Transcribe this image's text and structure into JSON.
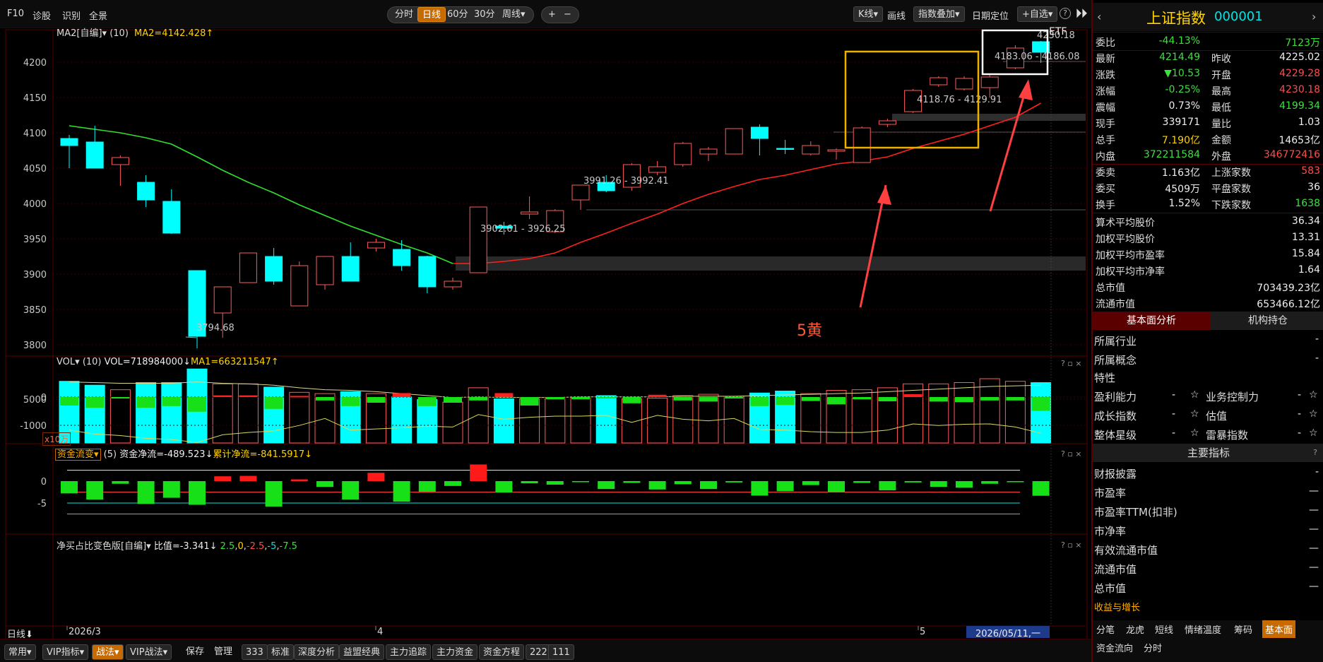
{
  "topbar": {
    "f10": "F10",
    "diagnose": "诊股",
    "identify": "识别",
    "fullview": "全景",
    "periods": [
      "分时",
      "日线",
      "60分",
      "30分",
      "周线▾"
    ],
    "zoom_in": "+",
    "zoom_out": "−",
    "kline": "K线▾",
    "draw": "画线",
    "overlay": "指数叠加▾",
    "date_locate": "日期定位",
    "watchlist": "+自选▾",
    "help": "?"
  },
  "main_panel": {
    "indicator_name": "MA2[自编]▾",
    "param": "(10)",
    "value_text": "MA2=4142.428↑",
    "y_ticks": [
      "4200",
      "4150",
      "4100",
      "4050",
      "4000",
      "3950",
      "3900",
      "3850",
      "3800"
    ],
    "annotations": [
      "3794.68",
      "3902.61 - 3926.25",
      "3991.26 - 3992.41",
      "4118.76 - 4129.91",
      "4183.06 - 4186.08",
      "4230.18"
    ],
    "etf_label": "ETF",
    "callout_text": "5黄"
  },
  "vol_panel": {
    "name": "VOL▾",
    "param": "(10)",
    "vol_text": "VOL=718984000↓",
    "ma_text": "MA1=663211547↑",
    "y_tick": "5000",
    "unit": "x10万"
  },
  "flow_panel": {
    "name": "资金流变▾",
    "param": "(5)",
    "net_text": "资金净流=-489.523↓",
    "acc_text": "累计净流=-841.5917↓",
    "y_ticks": [
      "0",
      "-1000"
    ]
  },
  "ratio_panel": {
    "name": "净买占比变色版[自编]▾",
    "value_text": "比值=-3.341↓",
    "levels": [
      "2.5",
      "0",
      "-2.5",
      "-5",
      "-7.5"
    ],
    "y_ticks": [
      "0",
      "-5"
    ]
  },
  "time_axis": {
    "period_label": "日线⬇",
    "months": [
      "2026/3",
      "4",
      "5"
    ],
    "cursor_date": "2026/05/11,一"
  },
  "bottombar": {
    "items": [
      "常用▾",
      "VIP指标▾",
      "战法▾",
      "VIP战法▾",
      "保存",
      "管理",
      "333",
      "标准",
      "深度分析",
      "益盟经典",
      "主力追踪",
      "主力资金",
      "资金方程",
      "222",
      "111"
    ]
  },
  "quote": {
    "name": "上证指数",
    "code": "000001",
    "rows": [
      {
        "l": "委比",
        "v": "-44.13%",
        "l2": "",
        "v2": "7123万",
        "c": "green",
        "c2": "green"
      },
      {
        "l": "最新",
        "v": "4214.49",
        "l2": "昨收",
        "v2": "4225.02",
        "c": "green",
        "c2": "white"
      },
      {
        "l": "涨跌",
        "v": "▼10.53",
        "l2": "开盘",
        "v2": "4229.28",
        "c": "green",
        "c2": "red"
      },
      {
        "l": "涨幅",
        "v": "-0.25%",
        "l2": "最高",
        "v2": "4230.18",
        "c": "green",
        "c2": "red"
      },
      {
        "l": "震幅",
        "v": "0.73%",
        "l2": "最低",
        "v2": "4199.34",
        "c": "white",
        "c2": "green"
      },
      {
        "l": "现手",
        "v": "339171",
        "l2": "量比",
        "v2": "1.03",
        "c": "white",
        "c2": "white"
      },
      {
        "l": "总手",
        "v": "7.190亿",
        "l2": "金额",
        "v2": "14653亿",
        "c": "yellow",
        "c2": "white"
      },
      {
        "l": "内盘",
        "v": "372211584",
        "l2": "外盘",
        "v2": "346772416",
        "c": "green",
        "c2": "red"
      },
      {
        "l": "委卖",
        "v": "1.163亿",
        "l2": "上涨家数",
        "v2": "583",
        "c": "white",
        "c2": "red"
      },
      {
        "l": "委买",
        "v": "4509万",
        "l2": "平盘家数",
        "v2": "36",
        "c": "white",
        "c2": "white"
      },
      {
        "l": "换手",
        "v": "1.52%",
        "l2": "下跌家数",
        "v2": "1638",
        "c": "white",
        "c2": "green"
      }
    ],
    "stats": [
      {
        "l": "算术平均股价",
        "v": "36.34"
      },
      {
        "l": "加权平均股价",
        "v": "13.31"
      },
      {
        "l": "加权平均市盈率",
        "v": "15.84"
      },
      {
        "l": "加权平均市净率",
        "v": "1.64"
      },
      {
        "l": "总市值",
        "v": "703439.23亿"
      },
      {
        "l": "流通市值",
        "v": "653466.12亿"
      }
    ],
    "tabs": [
      "基本面分析",
      "机构持仓"
    ],
    "fundamentals": [
      {
        "l": "所属行业",
        "v": "-"
      },
      {
        "l": "所属概念",
        "v": "-"
      }
    ],
    "traits_title": "特性",
    "traits": [
      {
        "l": "盈利能力",
        "v": "-",
        "l2": "业务控制力",
        "v2": "-"
      },
      {
        "l": "成长指数",
        "v": "-",
        "l2": "估值",
        "v2": "-"
      },
      {
        "l": "整体星级",
        "v": "-",
        "l2": "雷暴指数",
        "v2": "-"
      }
    ],
    "main_title": "主要指标",
    "main_items": [
      {
        "l": "财报披露",
        "v": "-"
      },
      {
        "l": "市盈率",
        "v": "—"
      },
      {
        "l": "市盈率TTM(扣非)",
        "v": "—"
      },
      {
        "l": "市净率",
        "v": "—"
      },
      {
        "l": "有效流通市值",
        "v": "—"
      },
      {
        "l": "流通市值",
        "v": "—"
      },
      {
        "l": "总市值",
        "v": "—"
      }
    ],
    "growth_link": "收益与增长",
    "bottom_tabs": [
      "分笔",
      "龙虎",
      "短线",
      "情绪温度",
      "筹码",
      "基本面",
      "资金流向",
      "分时"
    ]
  },
  "colors": {
    "up": "#ff5a5a",
    "down": "#00ffff",
    "ma": "#ff2020",
    "ma_early": "#30e030",
    "accent": "#c76a00",
    "box": "#f0b000"
  },
  "chart_data": {
    "type": "candlestick",
    "ylim": [
      3780,
      4240
    ],
    "candles": [
      {
        "o": 4092,
        "c": 4082,
        "h": 4097,
        "l": 4050,
        "up": false
      },
      {
        "o": 4087,
        "c": 4050,
        "h": 4110,
        "l": 4050,
        "up": false
      },
      {
        "o": 4055,
        "c": 4065,
        "h": 4068,
        "l": 4025,
        "up": true
      },
      {
        "o": 4030,
        "c": 4005,
        "h": 4040,
        "l": 3995,
        "up": false
      },
      {
        "o": 4003,
        "c": 3958,
        "h": 4020,
        "l": 3957,
        "up": false
      },
      {
        "o": 3905,
        "c": 3812,
        "h": 3905,
        "l": 3795,
        "up": false
      },
      {
        "o": 3845,
        "c": 3882,
        "h": 3882,
        "l": 3810,
        "up": true
      },
      {
        "o": 3888,
        "c": 3930,
        "h": 3930,
        "l": 3888,
        "up": true
      },
      {
        "o": 3925,
        "c": 3890,
        "h": 3937,
        "l": 3885,
        "up": false
      },
      {
        "o": 3855,
        "c": 3912,
        "h": 3918,
        "l": 3855,
        "up": true
      },
      {
        "o": 3885,
        "c": 3925,
        "h": 3925,
        "l": 3878,
        "up": true
      },
      {
        "o": 3925,
        "c": 3890,
        "h": 3945,
        "l": 3890,
        "up": false
      },
      {
        "o": 3937,
        "c": 3945,
        "h": 3950,
        "l": 3932,
        "up": true
      },
      {
        "o": 3935,
        "c": 3912,
        "h": 3948,
        "l": 3905,
        "up": false
      },
      {
        "o": 3925,
        "c": 3882,
        "h": 3926,
        "l": 3873,
        "up": false
      },
      {
        "o": 3882,
        "c": 3890,
        "h": 3895,
        "l": 3878,
        "up": true
      },
      {
        "o": 3902,
        "c": 3995,
        "h": 3995,
        "l": 3902,
        "up": true
      },
      {
        "o": 3965,
        "c": 3968,
        "h": 3974,
        "l": 3956,
        "up": false
      },
      {
        "o": 3985,
        "c": 3988,
        "h": 4010,
        "l": 3978,
        "up": true
      },
      {
        "o": 3960,
        "c": 3990,
        "h": 3992,
        "l": 3958,
        "up": true
      },
      {
        "o": 4005,
        "c": 4026,
        "h": 4026,
        "l": 3991,
        "up": true
      },
      {
        "o": 4030,
        "c": 4018,
        "h": 4040,
        "l": 4016,
        "up": false
      },
      {
        "o": 4023,
        "c": 4055,
        "h": 4057,
        "l": 4018,
        "up": true
      },
      {
        "o": 4044,
        "c": 4052,
        "h": 4060,
        "l": 4040,
        "up": true
      },
      {
        "o": 4055,
        "c": 4085,
        "h": 4087,
        "l": 4052,
        "up": true
      },
      {
        "o": 4070,
        "c": 4077,
        "h": 4080,
        "l": 4060,
        "up": true
      },
      {
        "o": 4070,
        "c": 4106,
        "h": 4106,
        "l": 4070,
        "up": true
      },
      {
        "o": 4108,
        "c": 4092,
        "h": 4112,
        "l": 4068,
        "up": false
      },
      {
        "o": 4077,
        "c": 4078,
        "h": 4090,
        "l": 4070,
        "up": false
      },
      {
        "o": 4070,
        "c": 4082,
        "h": 4088,
        "l": 4068,
        "up": true
      },
      {
        "o": 4074,
        "c": 4076,
        "h": 4078,
        "l": 4062,
        "up": true
      },
      {
        "o": 4058,
        "c": 4107,
        "h": 4109,
        "l": 4058,
        "up": true
      },
      {
        "o": 4112,
        "c": 4117,
        "h": 4120,
        "l": 4108,
        "up": true
      },
      {
        "o": 4130,
        "c": 4160,
        "h": 4162,
        "l": 4128,
        "up": true
      },
      {
        "o": 4168,
        "c": 4178,
        "h": 4180,
        "l": 4165,
        "up": true
      },
      {
        "o": 4162,
        "c": 4177,
        "h": 4180,
        "l": 4160,
        "up": true
      },
      {
        "o": 4164,
        "c": 4179,
        "h": 4182,
        "l": 4150,
        "up": true
      },
      {
        "o": 4192,
        "c": 4220,
        "h": 4224,
        "l": 4190,
        "up": true
      },
      {
        "o": 4229,
        "c": 4214,
        "h": 4230,
        "l": 4199,
        "up": false
      }
    ],
    "ma10": [
      4110,
      4105,
      4100,
      4093,
      4084,
      4066,
      4047,
      4030,
      4015,
      3998,
      3983,
      3968,
      3955,
      3942,
      3930,
      3915,
      3915,
      3918,
      3922,
      3930,
      3945,
      3958,
      3972,
      3985,
      4000,
      4013,
      4024,
      4034,
      4040,
      4048,
      4056,
      4060,
      4066,
      4078,
      4088,
      4098,
      4110,
      4122,
      4142
    ],
    "volume": [
      0.96,
      0.9,
      0.83,
      0.94,
      0.94,
      1.15,
      0.92,
      0.92,
      0.87,
      0.79,
      0.77,
      0.8,
      0.77,
      0.72,
      0.68,
      0.64,
      0.86,
      0.69,
      0.69,
      0.69,
      0.72,
      0.74,
      0.69,
      0.7,
      0.74,
      0.76,
      0.72,
      0.78,
      0.81,
      0.77,
      0.82,
      0.83,
      0.86,
      0.92,
      0.92,
      0.94,
      1.0,
      0.96,
      0.94
    ],
    "vol_ma": [
      0.95,
      0.94,
      0.93,
      0.93,
      0.93,
      0.95,
      0.93,
      0.92,
      0.9,
      0.86,
      0.83,
      0.82,
      0.8,
      0.77,
      0.74,
      0.71,
      0.72,
      0.71,
      0.71,
      0.71,
      0.72,
      0.72,
      0.72,
      0.72,
      0.73,
      0.73,
      0.73,
      0.74,
      0.75,
      0.76,
      0.77,
      0.78,
      0.8,
      0.82,
      0.84,
      0.86,
      0.88,
      0.89,
      0.9
    ],
    "net_flow": [
      -300,
      -380,
      -40,
      -380,
      -320,
      -520,
      60,
      60,
      -420,
      40,
      -120,
      -320,
      -200,
      140,
      -320,
      -200,
      -120,
      140,
      -300,
      -80,
      -80,
      -40,
      -220,
      80,
      -120,
      -160,
      -40,
      -320,
      -280,
      -140,
      -260,
      -80,
      -150,
      100,
      -160,
      -180,
      -120,
      -120,
      -489
    ],
    "acc_flow": [
      -760,
      -860,
      -900,
      -970,
      -1000,
      -1080,
      -880,
      -820,
      -780,
      -640,
      -460,
      -760,
      -730,
      -700,
      -660,
      -680,
      -360,
      -480,
      -430,
      -400,
      -400,
      -380,
      -560,
      -380,
      -480,
      -520,
      -460,
      -740,
      -760,
      -800,
      -820,
      -820,
      -760,
      -600,
      -640,
      -610,
      -600,
      -680,
      -840
    ],
    "ratio": [
      -2.8,
      -4.2,
      -0.6,
      -5.2,
      -3.8,
      -5.4,
      1.1,
      1.2,
      -5.8,
      0.4,
      -1.3,
      -4.2,
      1.9,
      -4.7,
      -2.4,
      -1.1,
      3.8,
      -2.6,
      -0.5,
      -0.8,
      -0.2,
      -1.8,
      -0.4,
      -1.9,
      -0.7,
      -1.8,
      -0.3,
      -3.3,
      -2.3,
      -0.9,
      -2.5,
      -0.4,
      -2.1,
      -0.3,
      -1.3,
      -1.5,
      -0.6,
      0,
      -3.341
    ]
  }
}
